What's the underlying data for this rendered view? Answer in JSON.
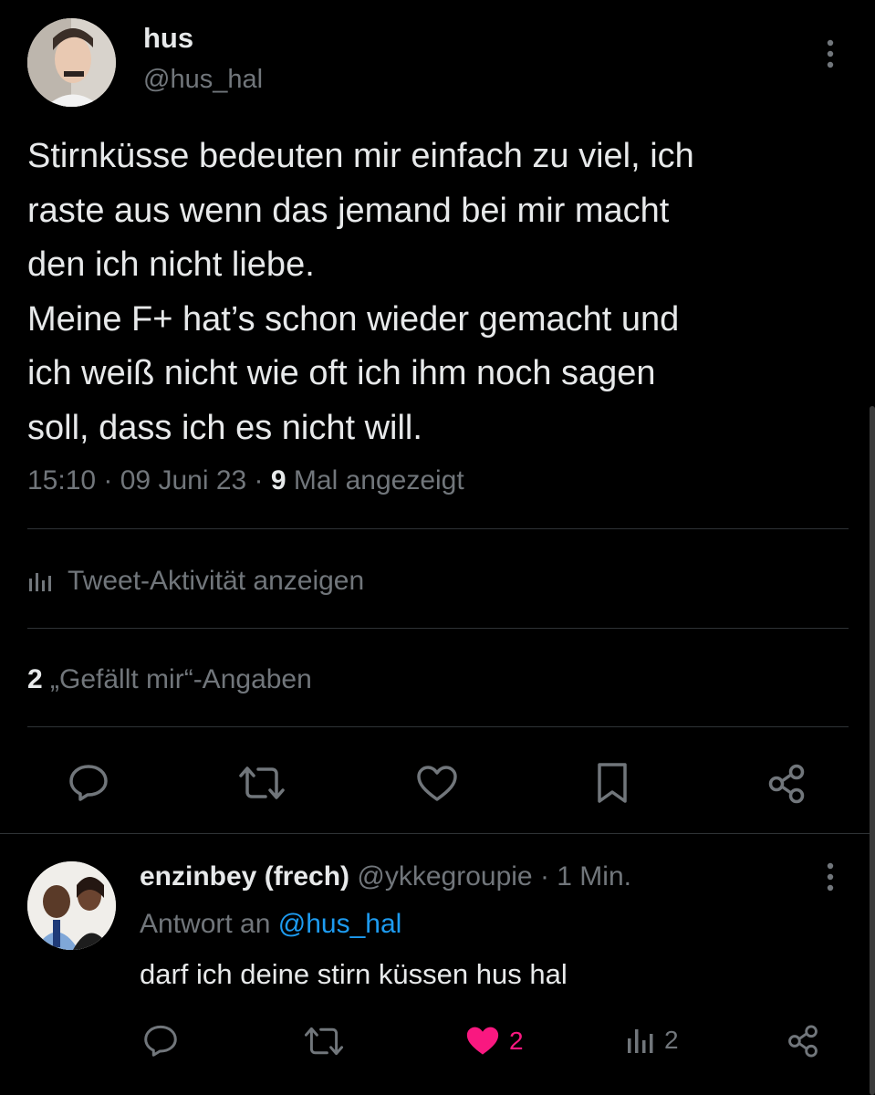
{
  "tweet": {
    "author_name": "hus",
    "author_handle": "@hus_hal",
    "text_lines": [
      "Stirnküsse bedeuten mir einfach zu viel, ich",
      "raste aus wenn das jemand bei mir macht",
      "den ich nicht liebe.",
      "Meine F+ hat’s schon wieder gemacht und",
      "ich weiß nicht wie oft ich ihm noch sagen",
      "soll, dass ich es nicht will."
    ],
    "time": "15:10",
    "date": "09 Juni 23",
    "views_count": "9",
    "views_label": "Mal angezeigt",
    "activity_label": "Tweet-Aktivität anzeigen",
    "likes_count": "2",
    "likes_label": "„Gefällt mir“-Angaben",
    "actions": [
      "reply-icon",
      "retweet-icon",
      "like-icon",
      "bookmark-icon",
      "share-icon"
    ]
  },
  "reply": {
    "author_name": "enzinbey (frech)",
    "author_handle": "@ykkegroupie",
    "time_ago": "1 Min.",
    "replying_prefix": "Antwort an",
    "replying_to": "@hus_hal",
    "text": "darf ich deine stirn küssen hus hal",
    "like_count": "2",
    "views_count": "2"
  },
  "colors": {
    "background": "#000000",
    "text": "#e7e9ea",
    "muted": "#71767b",
    "link": "#1d9bf0",
    "like": "#f91880",
    "divider": "#2f3336"
  }
}
